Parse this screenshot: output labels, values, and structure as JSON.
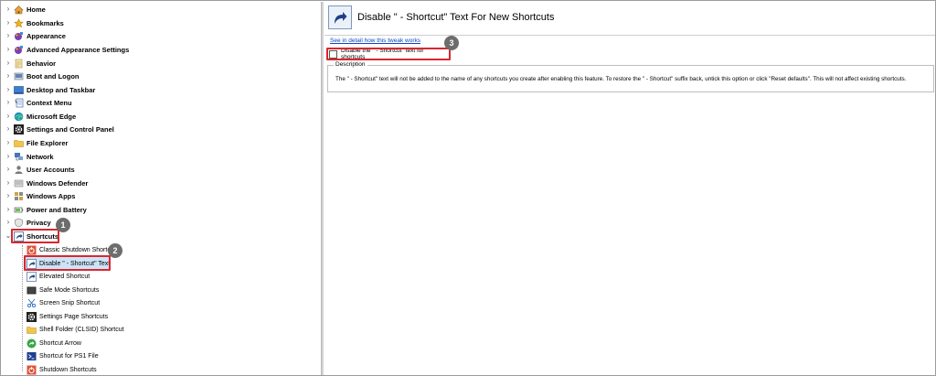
{
  "tree": {
    "categories": [
      {
        "label": "Home",
        "icon": "home-icon"
      },
      {
        "label": "Bookmarks",
        "icon": "star-icon"
      },
      {
        "label": "Appearance",
        "icon": "paint-icon"
      },
      {
        "label": "Advanced Appearance Settings",
        "icon": "paint-icon"
      },
      {
        "label": "Behavior",
        "icon": "behavior-icon"
      },
      {
        "label": "Boot and Logon",
        "icon": "boot-icon"
      },
      {
        "label": "Desktop and Taskbar",
        "icon": "desktop-icon"
      },
      {
        "label": "Context Menu",
        "icon": "context-menu-icon"
      },
      {
        "label": "Microsoft Edge",
        "icon": "edge-icon"
      },
      {
        "label": "Settings and Control Panel",
        "icon": "gear-icon"
      },
      {
        "label": "File Explorer",
        "icon": "folder-icon"
      },
      {
        "label": "Network",
        "icon": "network-icon"
      },
      {
        "label": "User Accounts",
        "icon": "user-icon"
      },
      {
        "label": "Windows Defender",
        "icon": "defender-icon"
      },
      {
        "label": "Windows Apps",
        "icon": "apps-icon"
      },
      {
        "label": "Power and Battery",
        "icon": "battery-icon"
      },
      {
        "label": "Privacy",
        "icon": "privacy-icon"
      },
      {
        "label": "Shortcuts",
        "icon": "shortcut-icon"
      }
    ],
    "children": [
      {
        "label": "Classic Shutdown Shortcuts",
        "icon": "shutdown-icon"
      },
      {
        "label": "Disable \" - Shortcut\" Text",
        "icon": "shortcut-arrow-icon"
      },
      {
        "label": "Elevated Shortcut",
        "icon": "shortcut-arrow-icon"
      },
      {
        "label": "Safe Mode Shortcuts",
        "icon": "safe-mode-icon"
      },
      {
        "label": "Screen Snip Shortcut",
        "icon": "scissors-icon"
      },
      {
        "label": "Settings Page Shortcuts",
        "icon": "gear-icon"
      },
      {
        "label": "Shell Folder (CLSID) Shortcut",
        "icon": "folder-icon"
      },
      {
        "label": "Shortcut Arrow",
        "icon": "arrow-icon"
      },
      {
        "label": "Shortcut for PS1 File",
        "icon": "powershell-icon"
      },
      {
        "label": "Shutdown Shortcuts",
        "icon": "shutdown-icon"
      }
    ]
  },
  "badges": [
    "1",
    "2",
    "3"
  ],
  "panel": {
    "title": "Disable \" - Shortcut\" Text For New Shortcuts",
    "link": "See in detail how this tweak works",
    "checkbox_label": "Disable the \" - Shortcut\" text for shortcuts",
    "description_legend": "Description",
    "description": "The \" - Shortcut\" text will not be added to the name of any shortcuts you create after enabling this feature. To restore the \" - Shortcut\" suffix back, untick this option or click \"Reset defaults\". This will not affect existing shortcuts."
  }
}
